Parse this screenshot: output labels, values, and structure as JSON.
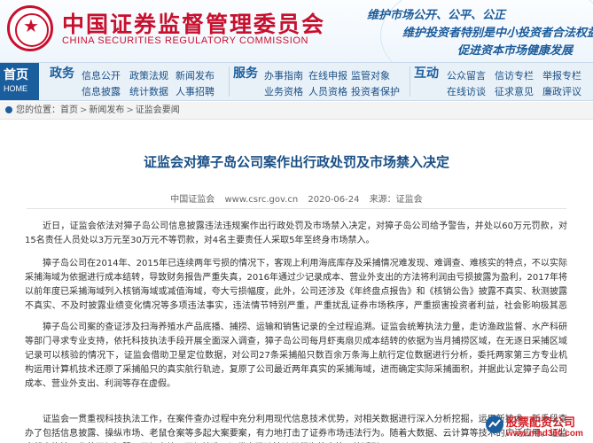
{
  "header": {
    "logo_cn": "中国证券监督管理委员会",
    "logo_en": "CHINA SECURITIES REGULATORY COMMISSION",
    "slogans": [
      "维护市场公开、公平、公正",
      "维护投资者特别是中小投资者合法权益",
      "促进资本市场健康发展"
    ]
  },
  "nav": {
    "home_cn": "首页",
    "home_en": "HOME",
    "sections": [
      {
        "title": "政务",
        "links": [
          "信息公开",
          "政策法规",
          "新闻发布",
          "信息披露",
          "统计数据",
          "人事招聘"
        ]
      },
      {
        "title": "服务",
        "links": [
          "办事指南",
          "在线申报",
          "监管对象",
          "业务资格",
          "人员资格",
          "投资者保护"
        ]
      },
      {
        "title": "互动",
        "links": [
          "公众留言",
          "信访专栏",
          "举报专栏",
          "在线访谈",
          "征求意见",
          "廉政评议"
        ]
      }
    ]
  },
  "breadcrumb": {
    "prefix": "您的位置：",
    "items": [
      "首页",
      "新闻发布",
      "证监会要闻"
    ],
    "separator": ">"
  },
  "article": {
    "title": "证监会对獐子岛公司案作出行政处罚及市场禁入决定",
    "source": "中国证监会",
    "url": "www.csrc.gov.cn",
    "date": "2020-06-24",
    "origin": "来源：证监会",
    "paragraphs": [
      "近日，证监会依法对獐子岛公司信息披露违法违规案作出行政处罚及市场禁入决定，对獐子岛公司给予警告，并处以60万元罚款，对15名责任人员处以3万元至30万元不等罚款，对4名主要责任人采取5年至终身市场禁入。",
      "獐子岛公司在2014年、2015年已连续两年亏损的情况下，客观上利用海底库存及采捕情况难发现、难调查、难核实的特点，不以实际采捕海域为依据进行成本结转，导致财务报告严重失真，2016年通过少记录成本、营业外支出的方法将利润由亏损披露为盈利，2017年将以前年度已采捕海域列入核销海域或减值海域，夸大亏损幅度，此外，公司还涉及《年终盘点报告》和《核销公告》披露不真实、秋测披露不真实、不及时披露业绩变化情况等多项违法事实，违法情节特别严重，严重扰乱证券市场秩序，严重损害投资者利益，社会影响极其恶劣。",
      "獐子岛公司案的查证涉及扫海养殖水产品底播、捕捞、运输和销售记录的全过程追溯。证监会统筹执法力量，走访渔政监督、水产科研等部门寻求专业支持，依托科技执法手段开展全面深入调查，獐子岛公司每月虾夷扇贝成本结转的依据为当月捕捞区域，在无逐日采捕区域记录可以核验的情况下，证监会借助卫星定位数据，对公司27条采捕船只数百余万条海上航行定位数据进行分析，委托两家第三方专业机构运用计算机技术还原了采捕船只的真实航行轨迹，复原了公司最近两年真实的采捕海域，进而确定实际采捕面积，并据此认定獐子岛公司成本、营业外支出、利润等存在虚假。",
      "证监会一贯重视科技执法工作，在案件查办过程中充分利用现代信息技术优势，对相关数据进行深入分析挖掘，运用新技术、新手段查办了包括信息披露、操纵市场、老鼠仓案等多起大案要案，有力地打击了证券市场违法行为。随着大数据、云计算等技术的广泛应用，证监会稽查执法工作将更加智慧、更加高效、更加精准，证券市场违法违规行为将会将无处遁形。"
    ]
  },
  "watermark": {
    "text": "股票配资公司",
    "url": "www.mhd360.com"
  },
  "colors": {
    "brand_red": "#c8102e",
    "nav_blue": "#1a5e9e",
    "title_blue": "#1a4f85"
  }
}
